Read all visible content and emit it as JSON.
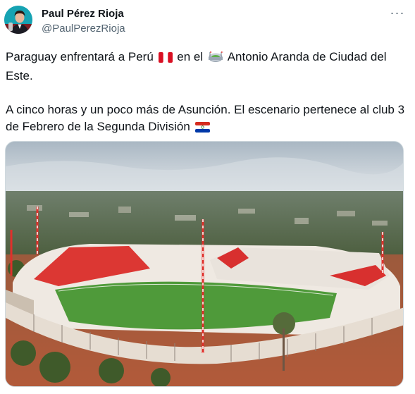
{
  "author": {
    "display_name": "Paul Pérez Rioja",
    "handle": "@PaulPerezRioja",
    "avatar_icon": "avatar-photo"
  },
  "more_menu": {
    "label": "···",
    "icon": "more-options-icon"
  },
  "tweet": {
    "line1_part1": "Paraguay enfrentará a Perú",
    "line1_part2": "en el",
    "line1_part3": "Antonio Aranda de Ciudad del Este.",
    "line2_part1": "A cinco horas y un poco más de Asunción. El escenario pertenece al club 3 de Febrero de la Segunda División",
    "emoji_peru_flag": "peru-flag-icon",
    "emoji_stadium": "stadium-icon",
    "emoji_paraguay_flag": "paraguay-flag-icon"
  },
  "media": {
    "type": "photo",
    "subject": "aerial-stadium-photo"
  },
  "colors": {
    "text_primary": "#0f1419",
    "text_secondary": "#536471",
    "border": "#cfd9de",
    "stand_red": "#d8302f",
    "pitch_green": "#4f9a3a"
  }
}
